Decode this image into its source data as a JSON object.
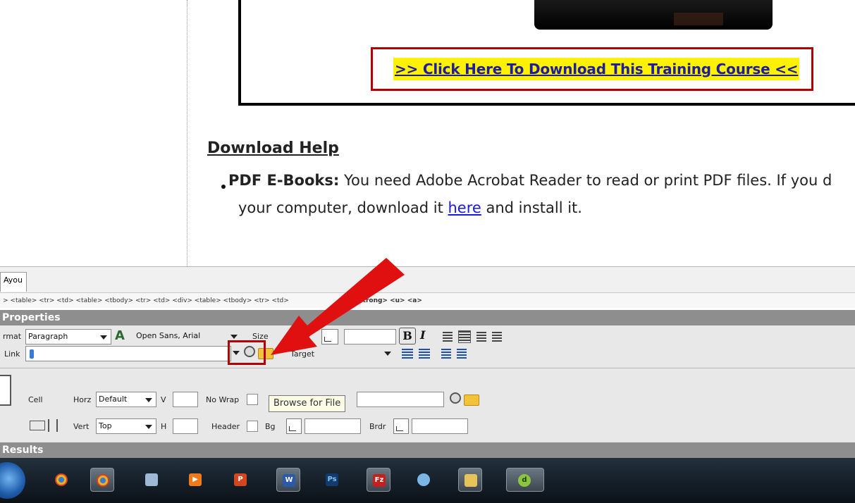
{
  "page": {
    "download_link": ">> Click Here To Download This Training Course <<",
    "help_heading": "Download Help",
    "help_item_title": "PDF E-Books:",
    "help_item_text": " You need Adobe Acrobat Reader to read or print PDF files. If you d",
    "help_line2_pre": "your computer, download it ",
    "help_line2_link": "here",
    "help_line2_post": " and install it."
  },
  "editor": {
    "doc_tab": "Ayou",
    "tag_selector": "> <table> <tr> <td> <table> <tbody> <tr> <td> <div> <table> <tbody> <tr> <td>",
    "tag_selector_tail": "<strong> <u> <a>",
    "properties_title": "Properties",
    "results_title": "Results"
  },
  "properties": {
    "format_label": "rmat",
    "format_value": "Paragraph",
    "font_value": "Open Sans, Arial",
    "size_label": "Size",
    "link_label": "Link",
    "link_value": "",
    "target_label": "Target",
    "target_value": "",
    "bold": "B",
    "italic": "I",
    "cell_label": "Cell",
    "horz_label": "Horz",
    "horz_value": "Default",
    "w_label": "V",
    "nowrap_label": "No Wrap",
    "vert_label": "Vert",
    "vert_value": "Top",
    "h_label": "H",
    "header_label": "Header",
    "bg_label": "Bg",
    "brdr_label": "Brdr",
    "tooltip": "Browse for File"
  },
  "taskbar": {
    "apps": [
      "chrome-icon",
      "chrome-icon",
      "notepad-icon",
      "media-player-icon",
      "powerpoint-icon",
      "word-icon",
      "photoshop-icon",
      "filezilla-icon",
      "quicktime-icon",
      "explorer-icon",
      "dreamweaver-icon"
    ]
  },
  "colors": {
    "highlight_red": "#b20000",
    "link_highlight": "#fff200",
    "arrow": "#e01010",
    "panel_header": "#8e8e8e"
  }
}
